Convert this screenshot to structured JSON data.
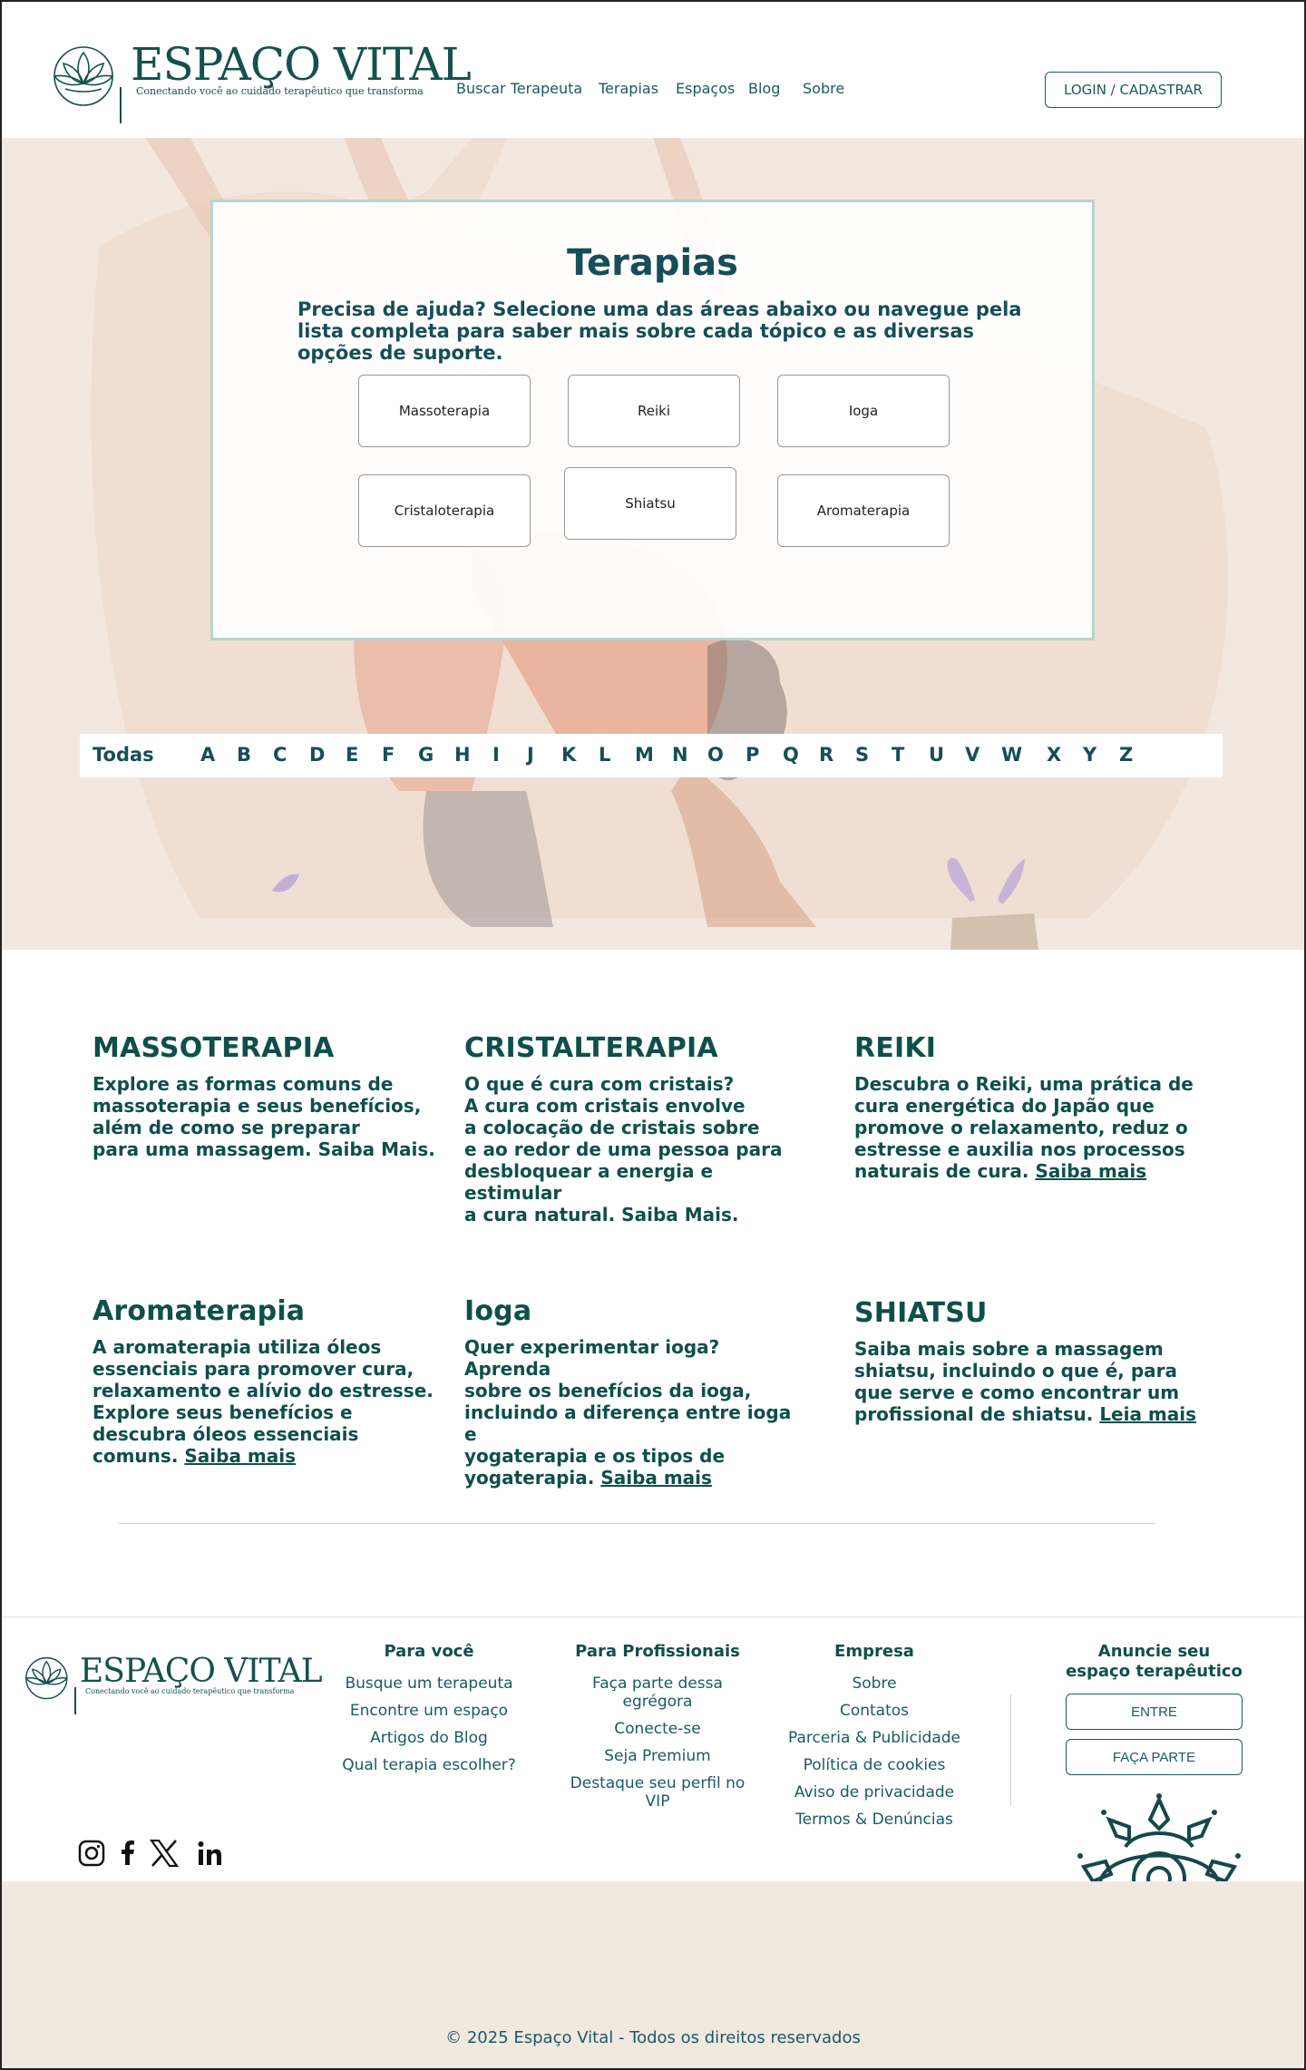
{
  "header": {
    "logo_title": "ESPAÇO VITAL",
    "logo_tagline": "Conectando você ao cuidado terapêutico que transforma",
    "nav": [
      "Buscar Terapeuta",
      "Terapias",
      "Espaços",
      "Blog",
      "Sobre"
    ],
    "login_label": "LOGIN / CADASTRAR"
  },
  "hero": {
    "title": "Terapias",
    "description": "Precisa de ajuda? Selecione uma das áreas abaixo ou navegue pela lista completa para saber mais sobre cada tópico e as diversas opções de suporte.",
    "tiles": [
      "Massoterapia",
      "Reiki",
      "Ioga",
      "Cristaloterapia",
      "Shiatsu",
      "Aromaterapia"
    ]
  },
  "alphabet": {
    "all_label": "Todas",
    "letters": [
      "A",
      "B",
      "C",
      "D",
      "E",
      "F",
      "G",
      "H",
      "I",
      "J",
      "K",
      "L",
      "M",
      "N",
      "O",
      "P",
      "Q",
      "R",
      "S",
      "T",
      "U",
      "V",
      "W",
      "X",
      "Y",
      "Z"
    ]
  },
  "articles": [
    {
      "title": "MASSOTERAPIA",
      "body": "Explore as formas comuns de\nmassoterapia e seus benefícios,\nalém de como se preparar\npara uma massagem. Saiba Mais.",
      "link": ""
    },
    {
      "title": "CRISTALTERAPIA",
      "body": "O que é cura com cristais?\nA cura com cristais envolve\na colocação de cristais sobre\ne ao redor de uma pessoa para\ndesbloquear a energia e estimular\na cura natural. Saiba Mais.",
      "link": ""
    },
    {
      "title": "REIKI",
      "body": "Descubra o Reiki, uma prática de\ncura energética do Japão que\npromove o relaxamento, reduz o\nestresse e auxilia nos processos\nnaturais de cura. ",
      "link": "Saiba mais"
    },
    {
      "title": "Aromaterapia",
      "body": "A aromaterapia utiliza óleos\nessenciais para promover cura,\nrelaxamento e alívio do estresse.\nExplore seus benefícios e\ndescubra óleos essenciais\ncomuns. ",
      "link": "Saiba mais"
    },
    {
      "title": "Ioga",
      "body": "Quer experimentar ioga? Aprenda\nsobre os benefícios da ioga,\nincluindo a diferença entre ioga e\nyogaterapia e os tipos de\nyogaterapia. ",
      "link": "Saiba mais"
    },
    {
      "title": "SHIATSU",
      "body": "Saiba mais sobre a massagem\nshiatsu, incluindo o que é, para\nque serve e como encontrar um\nprofissional de shiatsu. ",
      "link": "Leia mais"
    }
  ],
  "footer": {
    "col1": {
      "title": "Para você",
      "links": [
        "Busque um terapeuta",
        "Encontre um espaço",
        "Artigos do Blog",
        "Qual terapia escolher?"
      ]
    },
    "col2": {
      "title": "Para Profissionais",
      "links": [
        "Faça parte dessa egrégora",
        "Conecte-se",
        "Seja Premium",
        "Destaque seu perfil no VIP"
      ]
    },
    "col3": {
      "title": "Empresa",
      "links": [
        "Sobre",
        "Contatos",
        "Parceria & Publicidade",
        "Política de cookies",
        "Aviso de privacidade",
        "Termos & Denúncias"
      ]
    },
    "advertise": {
      "title": "Anuncie seu espaço terapêutico",
      "enter_label": "ENTRE",
      "join_label": "FAÇA PARTE"
    },
    "social": [
      "instagram-icon",
      "facebook-icon",
      "x-icon",
      "linkedin-icon"
    ],
    "copyright": "© 2025 Espaço Vital - Todos os direitos reservados"
  },
  "colors": {
    "primary": "#0f4f4b",
    "hero_bg": "#f3e8e0",
    "footer_bg": "#f1e8e0"
  }
}
